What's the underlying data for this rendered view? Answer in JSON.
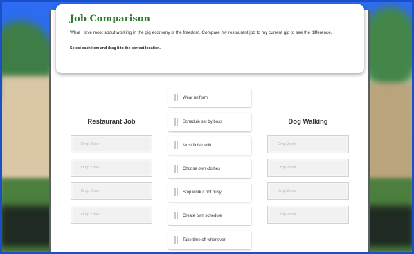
{
  "activity": {
    "title": "Job Comparison",
    "description": "What I love most about working in the gig economy is the freedom. Compare my restaurant job to my current gig to see the difference.",
    "instruction": "Select each item and drag it to the correct location."
  },
  "columns": {
    "left_title": "Restaurant Job",
    "right_title": "Dog Walking"
  },
  "drop_zone_label": "Drop Zone",
  "items": [
    "Wear uniform",
    "Schedule set by boss",
    "Must finish shift",
    "Choose own clothes",
    "Stop work if not busy",
    "Create own schedule",
    "Take time off whenever"
  ],
  "colors": {
    "title_green": "#2c7a2c",
    "frame_blue": "#1a4fc9"
  }
}
